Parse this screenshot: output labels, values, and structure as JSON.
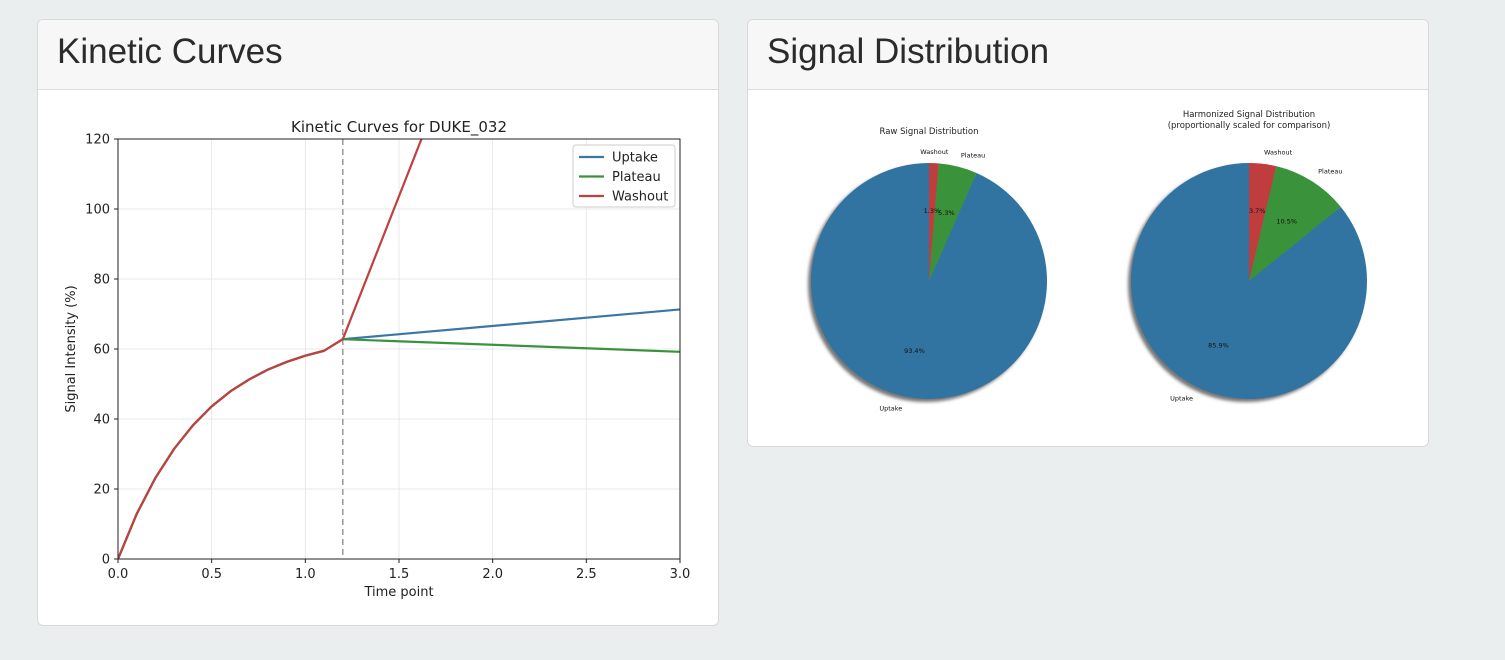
{
  "kinetic_card": {
    "title": "Kinetic Curves"
  },
  "signal_card": {
    "title": "Signal Distribution"
  },
  "chart_data": [
    {
      "type": "line",
      "title": "Kinetic Curves for DUKE_032",
      "xlabel": "Time point",
      "ylabel": "Signal Intensity (%)",
      "xlim": [
        0,
        3
      ],
      "ylim": [
        0,
        120
      ],
      "xticks": [
        "0.0",
        "0.5",
        "1.0",
        "1.5",
        "2.0",
        "2.5",
        "3.0"
      ],
      "yticks": [
        "0",
        "20",
        "40",
        "60",
        "80",
        "100",
        "120"
      ],
      "grid": true,
      "legend_position": "top-right",
      "vline_x": 1.2,
      "series": [
        {
          "name": "Uptake",
          "color": "#3a76a8",
          "x": [
            0,
            0.1,
            0.2,
            0.3,
            0.4,
            0.5,
            0.6,
            0.7,
            0.8,
            0.9,
            1.0,
            1.1,
            1.2,
            3.0
          ],
          "y": [
            0,
            12.9,
            23.2,
            31.5,
            38.2,
            43.6,
            47.9,
            51.3,
            54.1,
            56.3,
            58.1,
            59.5,
            62.8,
            71.3
          ]
        },
        {
          "name": "Plateau",
          "color": "#3c923c",
          "x": [
            0,
            0.1,
            0.2,
            0.3,
            0.4,
            0.5,
            0.6,
            0.7,
            0.8,
            0.9,
            1.0,
            1.1,
            1.2,
            3.0
          ],
          "y": [
            0,
            12.9,
            23.2,
            31.5,
            38.2,
            43.6,
            47.9,
            51.3,
            54.1,
            56.3,
            58.1,
            59.5,
            62.8,
            59.2
          ]
        },
        {
          "name": "Washout",
          "color": "#c0403f",
          "x": [
            0,
            0.1,
            0.2,
            0.3,
            0.4,
            0.5,
            0.6,
            0.7,
            0.8,
            0.9,
            1.0,
            1.1,
            1.2,
            1.62
          ],
          "y": [
            0,
            12.9,
            23.2,
            31.5,
            38.2,
            43.6,
            47.9,
            51.3,
            54.1,
            56.3,
            58.1,
            59.5,
            62.8,
            120
          ]
        }
      ]
    },
    {
      "type": "pie",
      "title": "Raw Signal Distribution",
      "labels": [
        "Uptake",
        "Plateau",
        "Washout"
      ],
      "values": [
        93.4,
        5.3,
        1.3
      ],
      "percent_labels": [
        "93.4%",
        "5.3%",
        "1.3%"
      ],
      "colors": [
        "#3274a1",
        "#3a923a",
        "#c03d3e"
      ]
    },
    {
      "type": "pie",
      "title": "Harmonized Signal Distribution",
      "subtitle": "(proportionally scaled for comparison)",
      "labels": [
        "Uptake",
        "Plateau",
        "Washout"
      ],
      "values": [
        85.9,
        10.5,
        3.7
      ],
      "percent_labels": [
        "85.9%",
        "10.5%",
        "3.7%"
      ],
      "colors": [
        "#3274a1",
        "#3a923a",
        "#c03d3e"
      ]
    }
  ]
}
